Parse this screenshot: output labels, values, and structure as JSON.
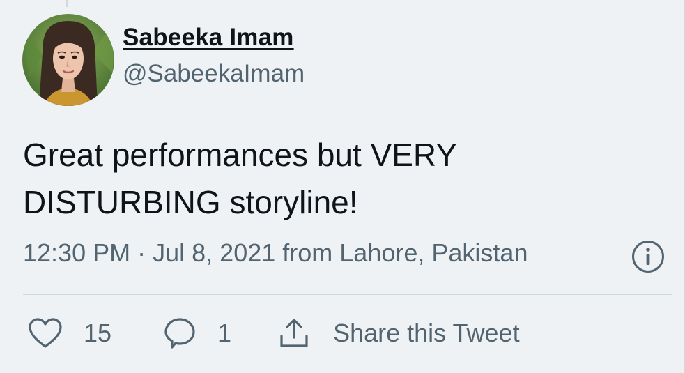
{
  "author": {
    "display_name": "Sabeeka Imam",
    "handle": "@SabeekaImam"
  },
  "tweet": {
    "text_line1": "Great performances but VERY",
    "text_line2": "DISTURBING storyline!",
    "time": "12:30 PM",
    "separator": "·",
    "date": "Jul 8, 2021",
    "location": "from Lahore, Pakistan"
  },
  "actions": {
    "like_count": "15",
    "reply_count": "1",
    "share_label": "Share this Tweet"
  },
  "icons": {
    "like": "heart-icon",
    "reply": "speech-bubble-icon",
    "share": "share-upload-icon",
    "info": "info-icon"
  },
  "colors": {
    "background": "#eef2f5",
    "text_primary": "#0f1419",
    "text_secondary": "#536471",
    "divider": "#cfd9de"
  }
}
